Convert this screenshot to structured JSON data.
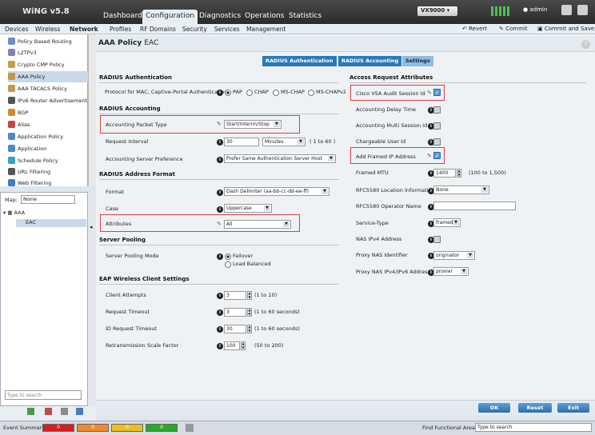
{
  "app": {
    "logo": "WiNG v5.8"
  },
  "top_tabs": [
    "Dashboard",
    "Configuration",
    "Diagnostics",
    "Operations",
    "Statistics"
  ],
  "device": "VX9000",
  "user": "admin",
  "nav_items": [
    "Devices",
    "Wireless",
    "Network",
    "Profiles",
    "RF Domains",
    "Security",
    "Services",
    "Management"
  ],
  "actions": {
    "revert": "Revert",
    "commit": "Commit",
    "commit_save": "Commit and Save"
  },
  "sidebar": [
    "Policy Based Routing",
    "L2TPv3",
    "Crypto CMP Policy",
    "AAA Policy",
    "AAA TACACS Policy",
    "IPv6 Router Advertisement",
    "BGP",
    "Alias",
    "Application Policy",
    "Application",
    "Schedule Policy",
    "URL Filtering",
    "Web Filtering"
  ],
  "map": {
    "label": "Map:",
    "value": "None",
    "root": "AAA",
    "child": "EAC"
  },
  "search_placeholder": "Type to search",
  "page": {
    "title": "AAA Policy",
    "sub": "EAC"
  },
  "subtabs": [
    "RADIUS Authentication",
    "RADIUS Accounting",
    "Settings"
  ],
  "left": {
    "radius_auth": {
      "title": "RADIUS Authentication",
      "label": "Protocol for MAC, Captive-Portal Authentication",
      "opts": [
        "PAP",
        "CHAP",
        "MS-CHAP",
        "MS-CHAPv2"
      ]
    },
    "radius_acct": {
      "title": "RADIUS Accounting",
      "packet_type": {
        "label": "Accounting Packet Type",
        "value": "Start/Interim/Stop"
      },
      "interval": {
        "label": "Request Interval",
        "value": "30",
        "unit": "Minutes",
        "range": "( 1 to 60 )"
      },
      "server_pref": {
        "label": "Accounting Server Preference",
        "value": "Prefer Same Authentication Server Host"
      }
    },
    "radius_addr": {
      "title": "RADIUS Address Format",
      "format": {
        "label": "Format",
        "value": "Dash Delimiter (aa-bb-cc-dd-ee-ff)"
      },
      "case": {
        "label": "Case",
        "value": "Uppercase"
      },
      "attributes": {
        "label": "Attributes",
        "value": "All"
      }
    },
    "pooling": {
      "title": "Server Pooling",
      "label": "Server Pooling Mode",
      "opts": [
        "Failover",
        "Load Balanced"
      ]
    },
    "eap": {
      "title": "EAP Wireless Client Settings",
      "rows": [
        {
          "label": "Client Attempts",
          "value": "3",
          "range": "(1 to 10)"
        },
        {
          "label": "Request Timeout",
          "value": "3",
          "range": "(1 to 60 seconds)"
        },
        {
          "label": "ID Request Timeout",
          "value": "30",
          "range": "(1 to 60 seconds)"
        },
        {
          "label": "Retransmission Scale Factor",
          "value": "100",
          "range": "(50 to 200)"
        }
      ]
    }
  },
  "right": {
    "title": "Access Request Attributes",
    "cisco": "Cisco VSA Audit Session Id",
    "delay": "Accounting Delay Time",
    "multi": "Accounting Multi Session Id",
    "chargeable": "Chargeable User Id",
    "framed_ip": "Add Framed IP Address",
    "mtu": {
      "label": "Framed MTU",
      "value": "1400",
      "range": "(100 to 1,500)"
    },
    "rfc_info": {
      "label": "RFC5580 Location Information",
      "value": "None"
    },
    "rfc_op": {
      "label": "RFC5580 Operator Name",
      "value": ""
    },
    "svc": {
      "label": "Service-Type",
      "value": "framed"
    },
    "nas_ipv4": "NAS IPv4 Address",
    "proxy_id": {
      "label": "Proxy NAS Identifier",
      "value": "originator"
    },
    "proxy_ip": {
      "label": "Proxy NAS IPv4/IPv6 Address",
      "value": "proxier"
    }
  },
  "buttons": {
    "ok": "OK",
    "reset": "Reset",
    "exit": "Exit"
  },
  "status": {
    "label": "Event Summary",
    "sev": [
      "0",
      "0",
      "0",
      "0"
    ],
    "find": "Find Functional Area",
    "find_ph": "Type to search"
  }
}
